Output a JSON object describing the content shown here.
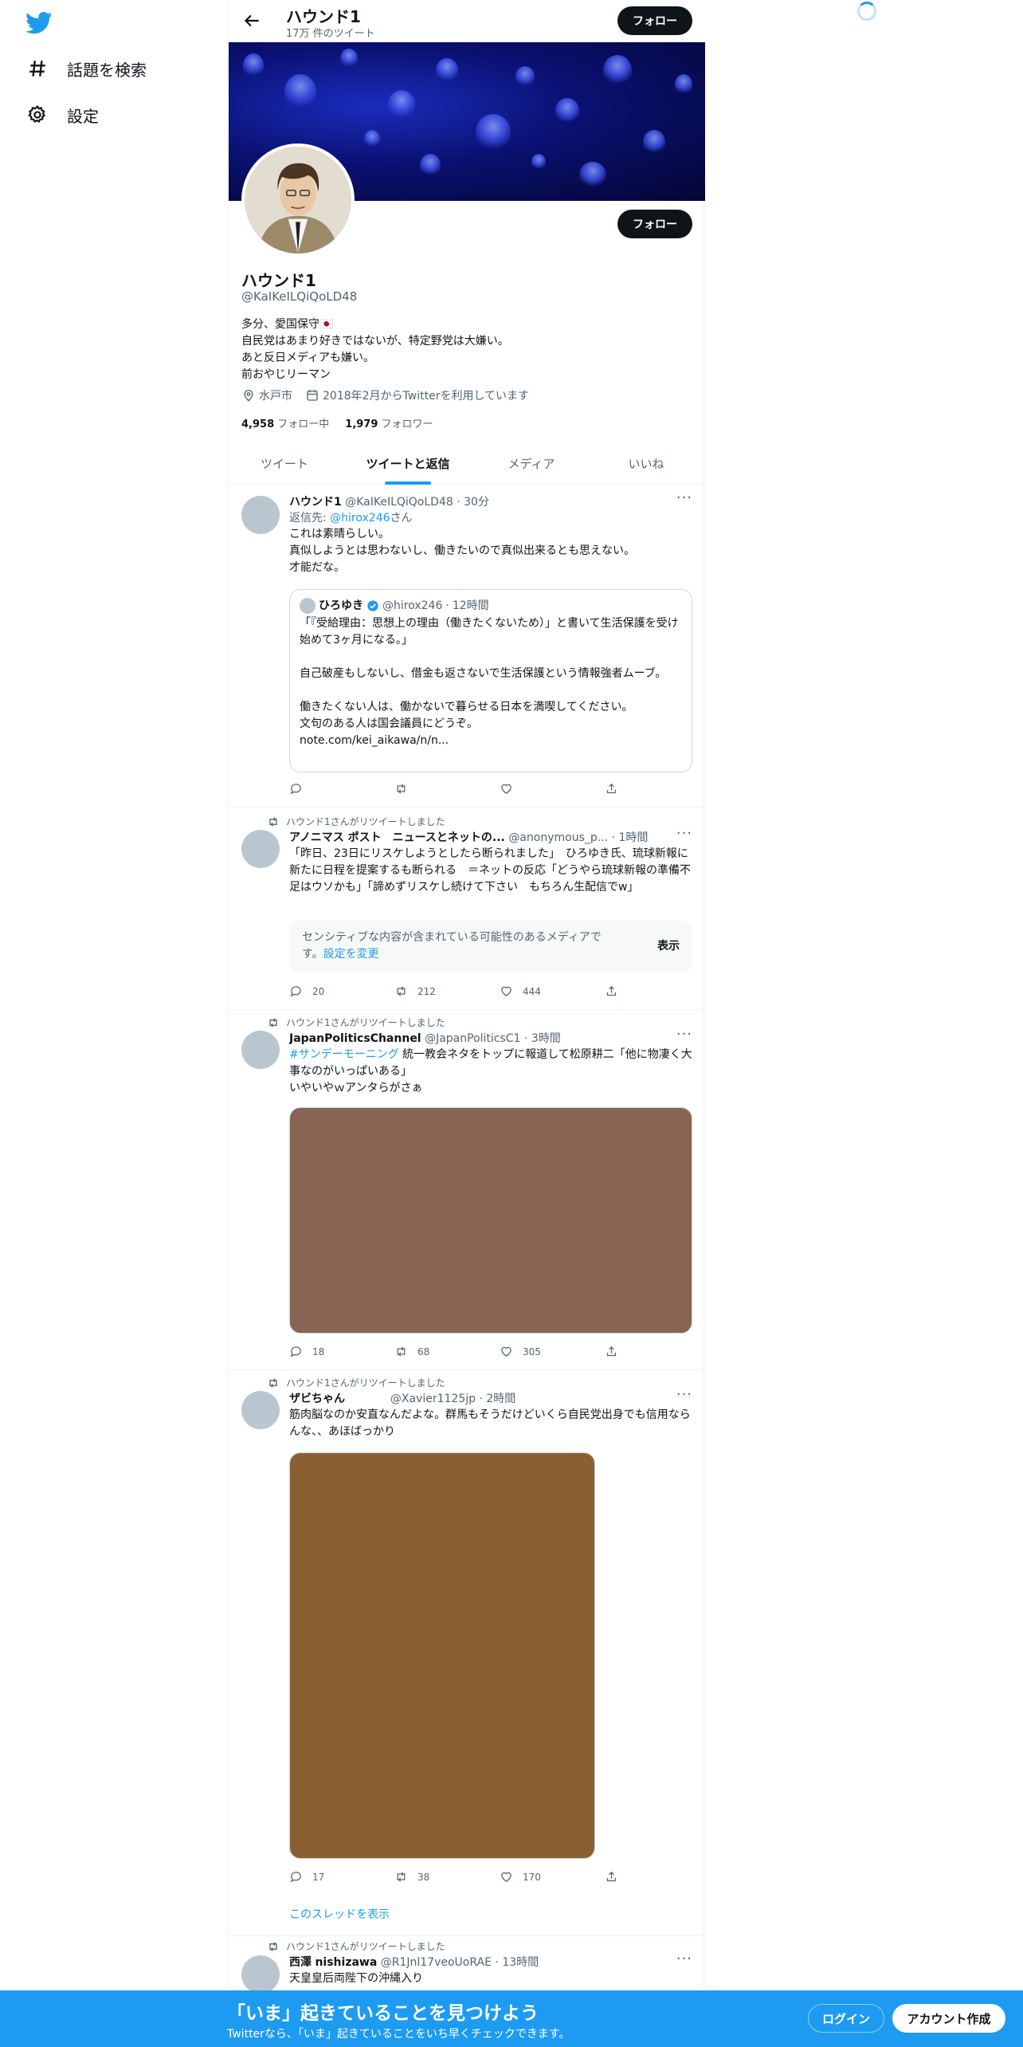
{
  "nav": {
    "explore": "話題を検索",
    "settings": "設定"
  },
  "header": {
    "title": "ハウンド1",
    "tweet_count": "17万 件のツイート",
    "follow": "フォロー"
  },
  "profile": {
    "follow": "フォロー",
    "name": "ハウンド1",
    "handle": "@KaIKeILQiQoLD48",
    "bio": [
      "多分、愛国保守🇯🇵",
      "自民党はあまり好きではないが、特定野党は大嫌い。",
      "あと反日メディアも嫌い。",
      "前おやじリーマン"
    ],
    "location": "水戸市",
    "joined": "2018年2月からTwitterを利用しています",
    "following_count": "4,958",
    "following_label": "フォロー中",
    "followers_count": "1,979",
    "followers_label": "フォロワー"
  },
  "tabs": [
    "ツイート",
    "ツイートと返信",
    "メディア",
    "いいね"
  ],
  "active_tab": "ツイートと返信",
  "tweets": [
    {
      "name": "ハウンド1",
      "handle": "@KaIKeILQiQoLD48",
      "time": "30分",
      "reply_prefix": "返信先: ",
      "reply_to": "@hirox246",
      "reply_suffix": "さん",
      "text": [
        "これは素晴らしい。",
        "真似しようとは思わないし、働きたいので真似出来るとも思えない。",
        "才能だな。"
      ],
      "quote": {
        "name": "ひろゆき",
        "handle": "@hirox246",
        "time": "12時間",
        "text": [
          "「『受給理由：思想上の理由（働きたくないため）」と書いて生活保護を受け始めて3ヶ月になる。」",
          "",
          "自己破産もしないし、借金も返さないで生活保護という情報強者ムーブ。",
          "",
          "働きたくない人は、働かないで暮らせる日本を満喫してください。",
          "文句のある人は国会議員にどうぞ。",
          "note.com/kei_aikawa/n/n..."
        ]
      }
    },
    {
      "retweeted_by": "ハウンド1さんがリツイートしました",
      "name": "アノニマス ポスト　ニュースとネットの...",
      "handle": "@anonymous_p...",
      "time": "1時間",
      "text": [
        "「昨日、23日にリスケしようとしたら断られました」　ひろゆき氏、琉球新報に新たに日程を提案するも断られる　＝ネットの反応「どうやら琉球新報の準備不足はウソかも」「諦めずリスケし続けて下さい　もちろん生配信でw」"
      ],
      "sensitive": "センシティブな内容が含まれている可能性のあるメディアです。",
      "sensitive_link": "設定を変更",
      "sensitive_button": "表示",
      "replies": "20",
      "retweets": "212",
      "likes": "444"
    },
    {
      "retweeted_by": "ハウンド1さんがリツイートしました",
      "name": "JapanPoliticsChannel",
      "handle": "@JapanPoliticsC1",
      "time": "3時間",
      "hashtag": "#サンデーモーニング",
      "text_after_hashtag": " 統一教会ネタをトップに報道して松原耕二「他に物凄く大事なのがいっぱいある」",
      "text": [
        "いやいやｗアンタらがさぁ"
      ],
      "media_color": "#876454",
      "replies": "18",
      "retweets": "68",
      "likes": "305"
    },
    {
      "retweeted_by": "ハウンド1さんがリツイートしました",
      "name": "ザビちゃん",
      "handle": "@Xavier1125jp",
      "time": "2時間",
      "text": [
        "筋肉脳なのか安直なんだよな。群馬もそうだけどいくら自民党出身でも信用ならんな、、あほばっかり"
      ],
      "media_color": "#8a6033",
      "replies": "17",
      "retweets": "38",
      "likes": "170",
      "thread_link": "このスレッドを表示"
    },
    {
      "retweeted_by": "ハウンド1さんがリツイートしました",
      "name": "西澤",
      "name2": "nishizawa",
      "handle": "@R1Jnl17veoUoRAE",
      "time": "13時間",
      "text": [
        "天皇皇后両陛下の沖縄入り"
      ]
    }
  ],
  "bottom": {
    "title": "「いま」起きていることを見つけよう",
    "subtitle": "Twitterなら、「いま」起きていることをいち早くチェックできます。",
    "login": "ログイン",
    "signup": "アカウント作成"
  },
  "colors": {
    "accent": "#1d9bf0",
    "text": "#0f1419",
    "muted": "#536471"
  }
}
